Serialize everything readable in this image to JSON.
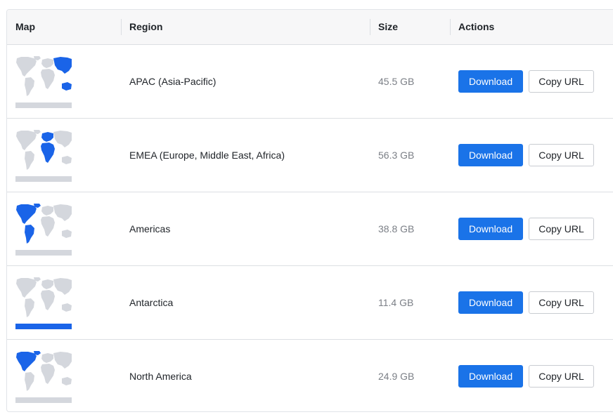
{
  "table": {
    "headers": {
      "map": "Map",
      "region": "Region",
      "size": "Size",
      "actions": "Actions"
    },
    "rows": [
      {
        "region": "APAC (Asia-Pacific)",
        "size": "45.5 GB",
        "download_label": "Download",
        "copy_label": "Copy URL",
        "highlight": "apac"
      },
      {
        "region": "EMEA (Europe, Middle East, Africa)",
        "size": "56.3 GB",
        "download_label": "Download",
        "copy_label": "Copy URL",
        "highlight": "emea"
      },
      {
        "region": "Americas",
        "size": "38.8 GB",
        "download_label": "Download",
        "copy_label": "Copy URL",
        "highlight": "americas"
      },
      {
        "region": "Antarctica",
        "size": "11.4 GB",
        "download_label": "Download",
        "copy_label": "Copy URL",
        "highlight": "antarctica"
      },
      {
        "region": "North America",
        "size": "24.9 GB",
        "download_label": "Download",
        "copy_label": "Copy URL",
        "highlight": "north-america"
      }
    ]
  },
  "colors": {
    "accent": "#1a73e8",
    "land": "#d4d7dd",
    "highlight": "#1a64e8"
  }
}
